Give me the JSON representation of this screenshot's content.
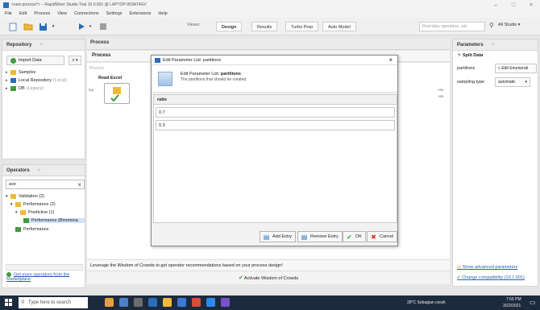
{
  "window": {
    "title": "<new process*> – RapidMiner Studio Trial 10.0.001 @ LAPTOP-959AT4GV",
    "minimize": "–",
    "maximize": "□",
    "close": "×"
  },
  "menu": [
    "File",
    "Edit",
    "Process",
    "View",
    "Connections",
    "Settings",
    "Extensions",
    "Help"
  ],
  "toolbar": {
    "views_label": "Views:",
    "tabs": [
      "Design",
      "Results",
      "Turbo Prep",
      "Auto Model"
    ],
    "active_tab": "Design",
    "find_placeholder": "Find data, operators...etc",
    "studio": "All Studio ▾"
  },
  "repository": {
    "title": "Repository",
    "import_label": "Import Data",
    "more_label": "≡ ▾",
    "items": [
      {
        "label": "Samples",
        "sub": ""
      },
      {
        "label": "Local Repository",
        "sub": "(Local)"
      },
      {
        "label": "DB",
        "sub": "(Legacy)"
      }
    ]
  },
  "operators": {
    "title": "Operators",
    "search_value": "ave",
    "items": [
      {
        "label": "Validation (2)"
      },
      {
        "label": "Performance (2)"
      },
      {
        "label": "Predictive (1)"
      },
      {
        "label": "Performance (Binomina"
      },
      {
        "label": "Performance"
      }
    ],
    "link": "Get more operators from the Marketplace"
  },
  "process": {
    "tab": "Process",
    "crumb": "Process",
    "canvas_label": "Process",
    "operator": "Read Excel",
    "port_in": "inp",
    "port_res": "res",
    "woc_text": "Leverage the Wisdom of Crowds to get operator recommendations based on your process design!",
    "woc_button": "Activate Wisdom of Crowds"
  },
  "parameters": {
    "title": "Parameters",
    "operator": "Split Data",
    "rows": [
      {
        "label": "partitions",
        "control": "Edit Enumerati"
      },
      {
        "label": "sampling type",
        "control": "automatic"
      }
    ],
    "advanced_link": "Show advanced parameters",
    "compat_link": "Change compatibility (10.1.001)"
  },
  "dialog": {
    "title": "Edit Parameter List: partitions",
    "header_prefix": "Edit Parameter List: ",
    "header_param": "partitions",
    "header_desc": "The partitions that should be created.",
    "column": "ratio",
    "rows": [
      "0.7",
      "0.3"
    ],
    "buttons": {
      "add": "Add Entry",
      "remove": "Remove Entry",
      "ok": "OK",
      "cancel": "Cancel"
    }
  },
  "taskbar": {
    "search": "Type here to search",
    "weather": "28°C Sebagian cerah",
    "time": "7:55 PM",
    "date": "3/22/2021"
  },
  "colors": {
    "accent": "#2a6ebb",
    "green": "#3f9b3f",
    "danger": "#d93025",
    "taskbar": "#1c2a3d"
  }
}
